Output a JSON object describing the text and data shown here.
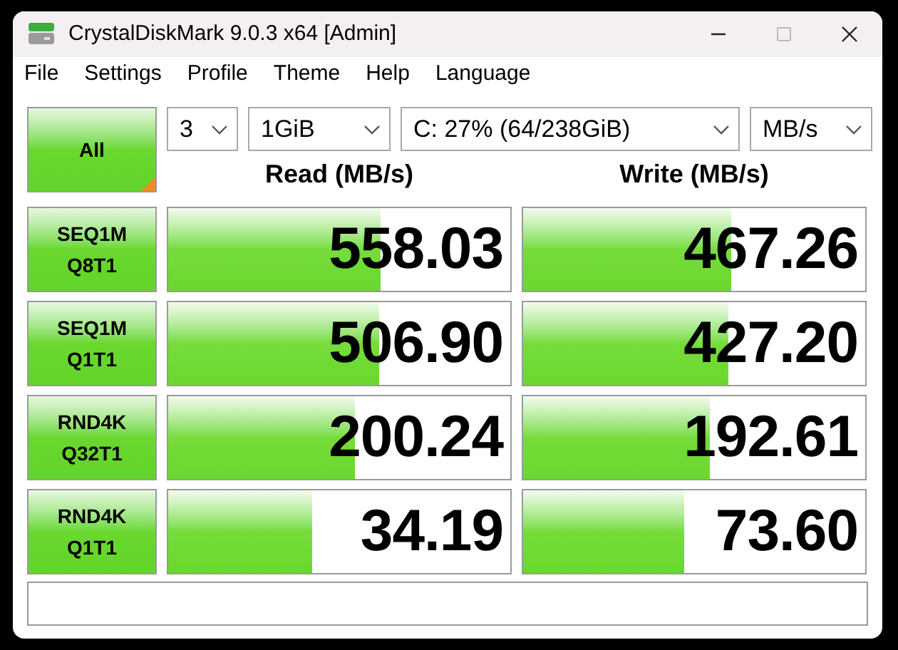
{
  "window": {
    "title": "CrystalDiskMark 9.0.3 x64 [Admin]"
  },
  "menu": [
    "File",
    "Settings",
    "Profile",
    "Theme",
    "Help",
    "Language"
  ],
  "all_button": {
    "label": "All"
  },
  "selectors": [
    {
      "value": "3"
    },
    {
      "value": "1GiB"
    },
    {
      "value": "C: 27% (64/238GiB)"
    },
    {
      "value": "MB/s"
    }
  ],
  "columns": [
    "Read (MB/s)",
    "Write (MB/s)"
  ],
  "tests": [
    {
      "label": [
        "SEQ1M",
        "Q8T1"
      ],
      "read": {
        "value": "558.03",
        "level": 0.62
      },
      "write": {
        "value": "467.26",
        "level": 0.61
      }
    },
    {
      "label": [
        "SEQ1M",
        "Q1T1"
      ],
      "read": {
        "value": "506.90",
        "level": 0.615
      },
      "write": {
        "value": "427.20",
        "level": 0.6
      }
    },
    {
      "label": [
        "RND4K",
        "Q32T1"
      ],
      "read": {
        "value": "200.24",
        "level": 0.545
      },
      "write": {
        "value": "192.61",
        "level": 0.545
      }
    },
    {
      "label": [
        "RND4K",
        "Q1T1"
      ],
      "read": {
        "value": "34.19",
        "level": 0.42
      },
      "write": {
        "value": "73.60",
        "level": 0.47
      }
    }
  ]
}
